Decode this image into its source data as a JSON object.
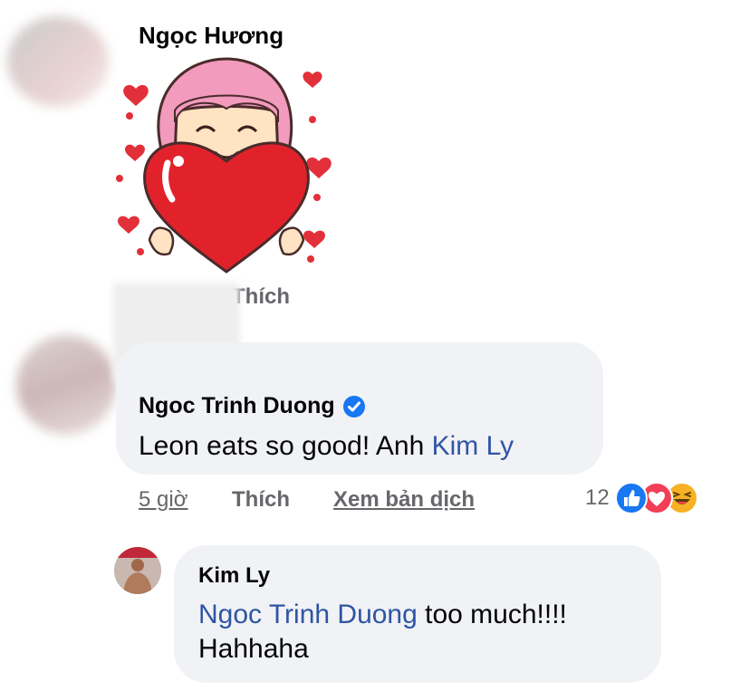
{
  "comments": [
    {
      "author": "Ngọc Hương",
      "sticker": "heart-hug-girl-sticker",
      "actions": {
        "like": "Thích"
      }
    },
    {
      "author": "Ngoc Trinh Duong",
      "verified_icon": "verified-badge-icon",
      "text_plain": "Leon eats so good! Anh",
      "mention": "Kim Ly",
      "actions": {
        "time": "5 giờ",
        "like": "Thích",
        "translate": "Xem bản dịch"
      },
      "reactions": {
        "count": "12",
        "icons": [
          "like-reaction-icon",
          "love-reaction-icon",
          "haha-reaction-icon"
        ]
      }
    },
    {
      "author": "Kim Ly",
      "mention": "Ngoc Trinh Duong",
      "text_after_mention": " too much!!!!",
      "text_line2": "Hahhaha"
    }
  ],
  "colors": {
    "link": "#2f55a4",
    "meta": "#65676b",
    "bubble": "#f0f2f5",
    "verified": "#1877f2",
    "like": "#1877f2",
    "love": "#f33e58",
    "haha": "#f7b125"
  }
}
